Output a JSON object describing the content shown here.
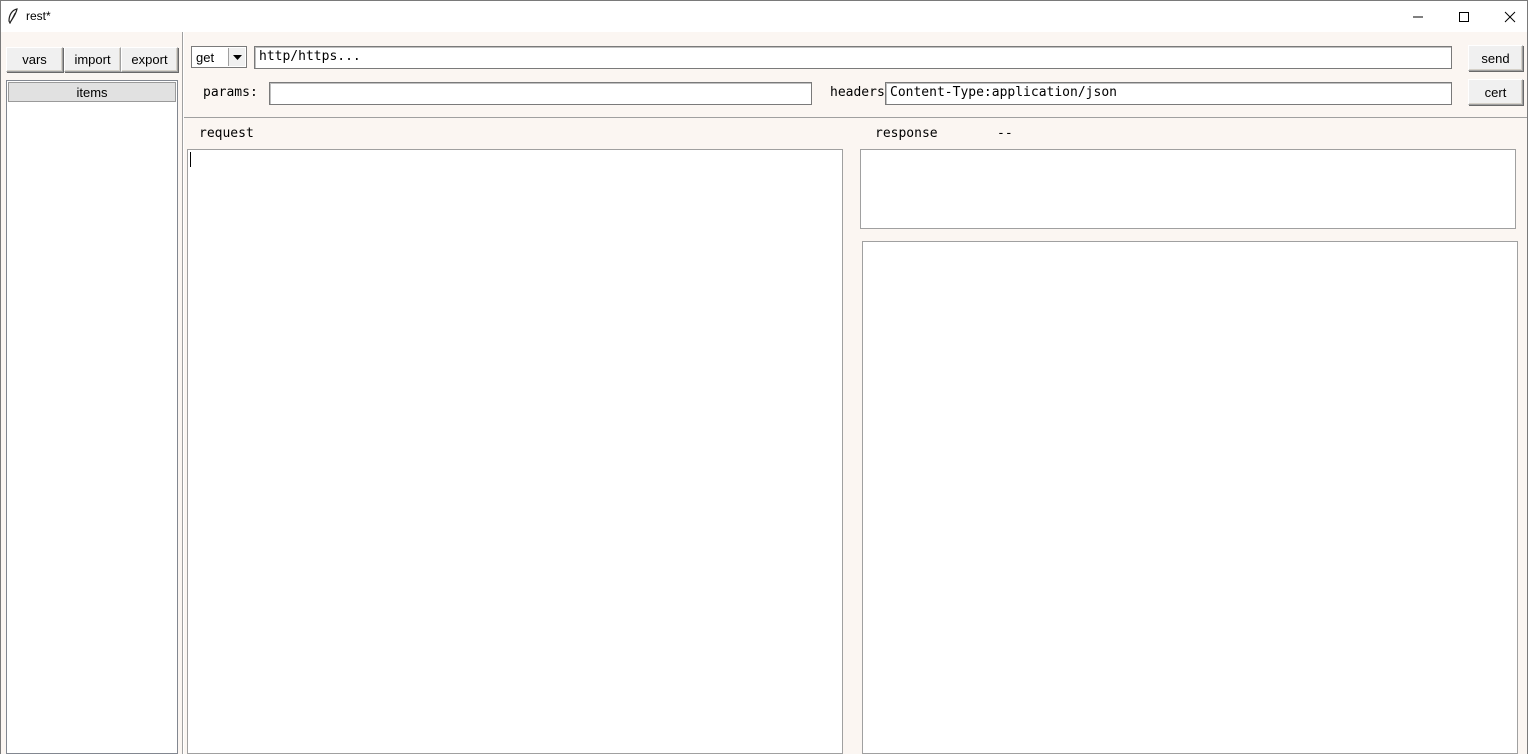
{
  "window": {
    "title": "rest*",
    "icon": "feather-icon"
  },
  "left_panel": {
    "buttons": {
      "vars": "vars",
      "import": "import",
      "export": "export"
    },
    "list_header": "items"
  },
  "request_bar": {
    "method": "get",
    "url_placeholder": "http/https...",
    "send": "send",
    "cert": "cert",
    "params_label": "params:",
    "params_value": "",
    "headers_label": "headers",
    "headers_value": "Content-Type:application/json"
  },
  "panes": {
    "request_label": "request",
    "response_label": "response",
    "response_status": "--"
  }
}
